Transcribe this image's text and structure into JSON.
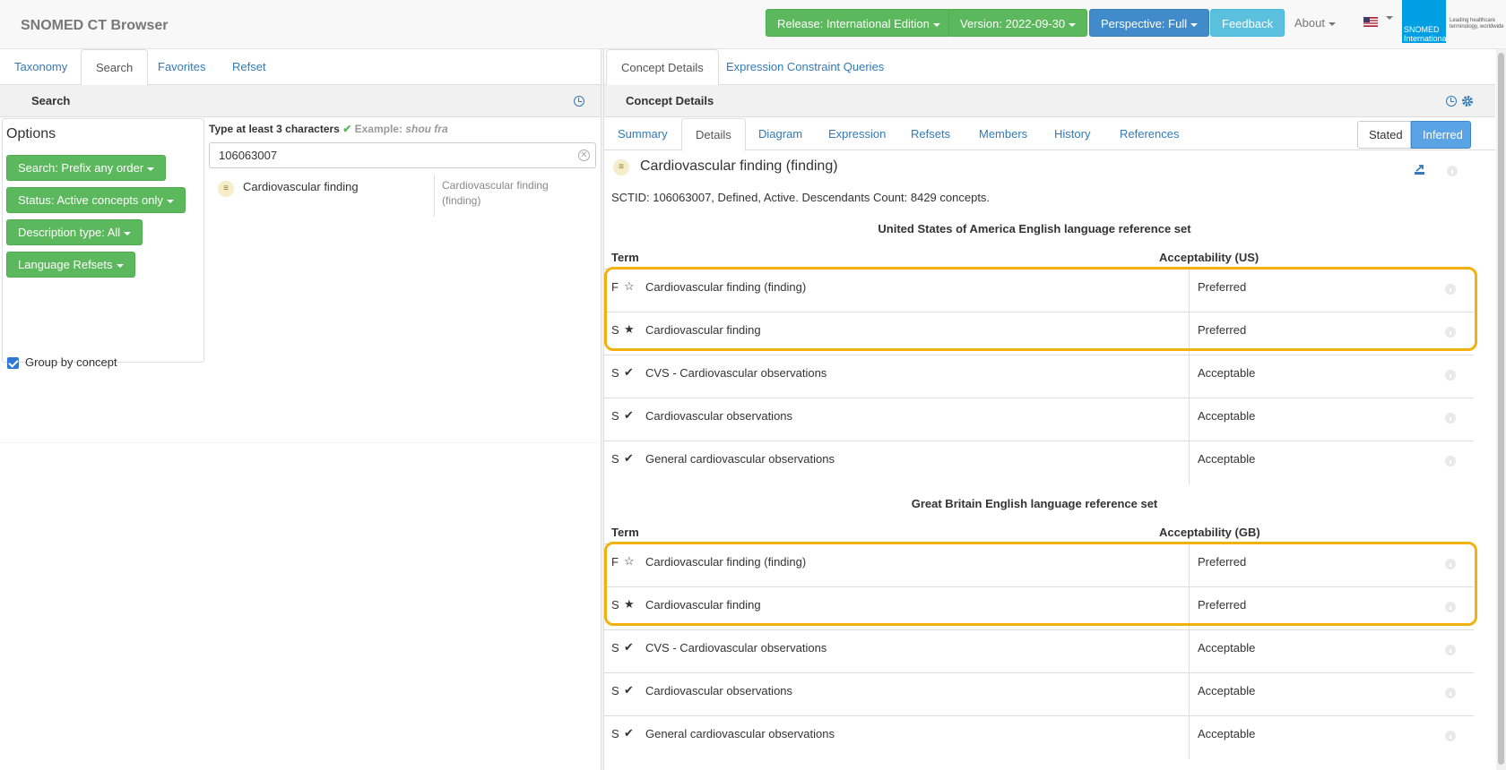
{
  "header": {
    "brand": "SNOMED CT Browser",
    "release_label": "Release: International Edition",
    "version_label": "Version: 2022-09-30",
    "perspective_label": "Perspective: Full",
    "feedback_label": "Feedback",
    "about_label": "About",
    "logo_text": "SNOMED International",
    "logo_tagline": "Leading healthcare terminology, worldwide"
  },
  "colors": {
    "success": "#5cb85c",
    "primary": "#428bca",
    "info": "#5bc0de",
    "link": "#337ab7",
    "highlight": "#f2b10f"
  },
  "left": {
    "tabs": [
      {
        "label": "Taxonomy"
      },
      {
        "label": "Search"
      },
      {
        "label": "Favorites"
      },
      {
        "label": "Refset"
      }
    ],
    "panel_title": "Search",
    "options": {
      "title": "Options",
      "buttons": [
        {
          "label": "Search: Prefix any order"
        },
        {
          "label": "Status: Active concepts only"
        },
        {
          "label": "Description type: All"
        },
        {
          "label": "Language Refsets"
        }
      ],
      "group_by_concept_label": "Group by concept",
      "group_by_concept_checked": true
    },
    "search": {
      "hint": "Type at least 3 characters",
      "hint_check": "✔",
      "example_label": "Example:",
      "example_value": "shou fra",
      "value": "106063007"
    },
    "results": [
      {
        "badge": "≡",
        "term": "Cardiovascular finding",
        "fsn": "Cardiovascular finding (finding)"
      }
    ]
  },
  "right": {
    "tabs": [
      {
        "label": "Concept Details"
      },
      {
        "label": "Expression Constraint Queries"
      }
    ],
    "panel_title": "Concept Details",
    "subtabs": [
      {
        "label": "Summary"
      },
      {
        "label": "Details"
      },
      {
        "label": "Diagram"
      },
      {
        "label": "Expression"
      },
      {
        "label": "Refsets"
      },
      {
        "label": "Members"
      },
      {
        "label": "History"
      },
      {
        "label": "References"
      }
    ],
    "view_toggle": {
      "stated": "Stated",
      "inferred": "Inferred"
    },
    "concept": {
      "badge": "≡",
      "title": "Cardiovascular finding (finding)",
      "sctid_line": "SCTID: 106063007, Defined, Active. Descendants Count: 8429 concepts."
    },
    "refsets": [
      {
        "title": "United States of America English language reference set",
        "term_header": "Term",
        "acceptability_header": "Acceptability  (US)",
        "rows": [
          {
            "type": "F",
            "symbol": "☆",
            "term": "Cardiovascular finding (finding)",
            "acceptability": "Preferred"
          },
          {
            "type": "S",
            "symbol": "★",
            "term": "Cardiovascular finding",
            "acceptability": "Preferred"
          },
          {
            "type": "S",
            "symbol": "✔",
            "term": "CVS - Cardiovascular observations",
            "acceptability": "Acceptable"
          },
          {
            "type": "S",
            "symbol": "✔",
            "term": "Cardiovascular observations",
            "acceptability": "Acceptable"
          },
          {
            "type": "S",
            "symbol": "✔",
            "term": "General cardiovascular observations",
            "acceptability": "Acceptable"
          }
        ]
      },
      {
        "title": "Great Britain English language reference set",
        "term_header": "Term",
        "acceptability_header": "Acceptability  (GB)",
        "rows": [
          {
            "type": "F",
            "symbol": "☆",
            "term": "Cardiovascular finding (finding)",
            "acceptability": "Preferred"
          },
          {
            "type": "S",
            "symbol": "★",
            "term": "Cardiovascular finding",
            "acceptability": "Preferred"
          },
          {
            "type": "S",
            "symbol": "✔",
            "term": "CVS - Cardiovascular observations",
            "acceptability": "Acceptable"
          },
          {
            "type": "S",
            "symbol": "✔",
            "term": "Cardiovascular observations",
            "acceptability": "Acceptable"
          },
          {
            "type": "S",
            "symbol": "✔",
            "term": "General cardiovascular observations",
            "acceptability": "Acceptable"
          }
        ]
      }
    ]
  }
}
